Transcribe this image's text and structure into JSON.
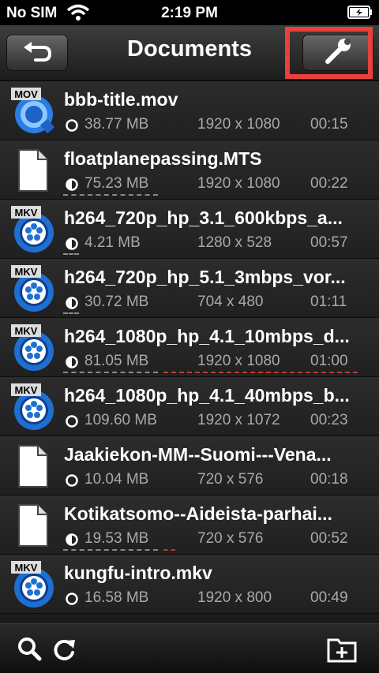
{
  "status_bar": {
    "carrier": "No SIM",
    "time": "2:19 PM"
  },
  "nav": {
    "title": "Documents"
  },
  "files": [
    {
      "name": "bbb-title.mov",
      "badge": "MOV",
      "type": "mov",
      "pie": "empty",
      "size": "38.77 MB",
      "resolution": "1920 x 1080",
      "duration": "00:15"
    },
    {
      "name": "floatplanepassing.MTS",
      "badge": "",
      "type": "doc",
      "pie": "half",
      "size": "75.23 MB",
      "resolution": "1920 x 1080",
      "duration": "00:22"
    },
    {
      "name": "h264_720p_hp_3.1_600kbps_a...",
      "badge": "MKV",
      "type": "mkv",
      "pie": "half",
      "size": "4.21 MB",
      "resolution": "1280 x 528",
      "duration": "00:57"
    },
    {
      "name": "h264_720p_hp_5.1_3mbps_vor...",
      "badge": "MKV",
      "type": "mkv",
      "pie": "half",
      "size": "30.72 MB",
      "resolution": "704 x 480",
      "duration": "01:11"
    },
    {
      "name": "h264_1080p_hp_4.1_10mbps_d...",
      "badge": "MKV",
      "type": "mkv",
      "pie": "half",
      "size": "81.05 MB",
      "resolution": "1920 x 1080",
      "duration": "01:00"
    },
    {
      "name": "h264_1080p_hp_4.1_40mbps_b...",
      "badge": "MKV",
      "type": "mkv",
      "pie": "empty",
      "size": "109.60 MB",
      "resolution": "1920 x 1072",
      "duration": "00:23"
    },
    {
      "name": "Jaakiekon-MM--Suomi---Vena...",
      "badge": "",
      "type": "doc",
      "pie": "empty",
      "size": "10.04 MB",
      "resolution": "720 x 576",
      "duration": "00:18"
    },
    {
      "name": "Kotikatsomo--Aideista-parhai...",
      "badge": "",
      "type": "doc",
      "pie": "half",
      "size": "19.53 MB",
      "resolution": "720 x 576",
      "duration": "00:52"
    },
    {
      "name": "kungfu-intro.mkv",
      "badge": "MKV",
      "type": "mkv",
      "pie": "empty",
      "size": "16.58 MB",
      "resolution": "1920 x 800",
      "duration": "00:49"
    }
  ],
  "colors": {
    "highlight": "#e8413d",
    "mkv_blue": "#1f6fd1",
    "underline_gray": "#8a8a8a",
    "underline_red": "#c0392b"
  }
}
